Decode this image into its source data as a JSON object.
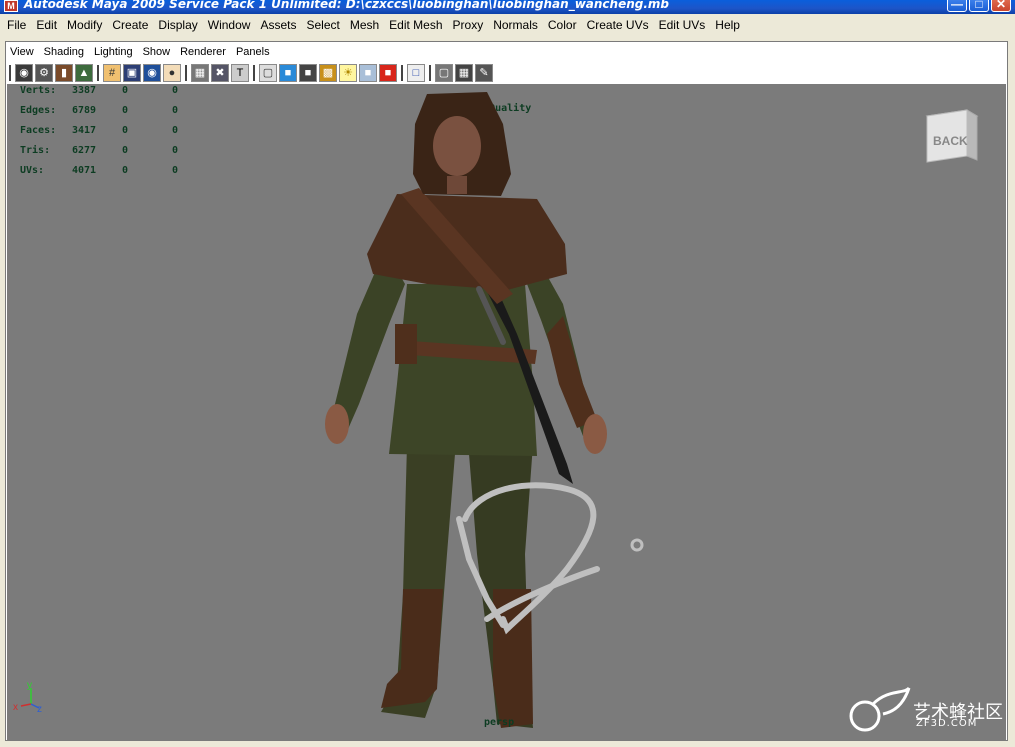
{
  "window": {
    "title": "Autodesk Maya 2009 Service Pack 1 Unlimited: D:\\czxccs\\luobinghan\\luobinghan_wancheng.mb",
    "icon": "maya-icon",
    "buttons": [
      "minimize",
      "maximize",
      "close"
    ]
  },
  "menubar": {
    "items": [
      "File",
      "Edit",
      "Modify",
      "Create",
      "Display",
      "Window",
      "Assets",
      "Select",
      "Mesh",
      "Edit Mesh",
      "Proxy",
      "Normals",
      "Color",
      "Create UVs",
      "Edit UVs",
      "Help"
    ]
  },
  "panel_menu": {
    "items": [
      "View",
      "Shading",
      "Lighting",
      "Show",
      "Renderer",
      "Panels"
    ]
  },
  "toolbar": {
    "groups": [
      [
        "camera-icon",
        "camera-attributes-icon",
        "bookmark-icon",
        "image-plane-icon"
      ],
      [
        "grid-icon",
        "film-gate-icon",
        "resolution-gate-icon",
        "gate-mask-icon"
      ],
      [
        "wireframe-icon",
        "uv-icon",
        "text-icon"
      ],
      [
        "wireframe-shaded-icon",
        "smooth-shade-icon",
        "flat-shade-icon",
        "textured-icon",
        "lights-icon",
        "xray-icon",
        "backface-icon"
      ],
      [
        "isolate-select-icon"
      ],
      [
        "xray-joints-icon",
        "hud-icon",
        "render-settings-icon"
      ]
    ]
  },
  "hud": {
    "rows": [
      {
        "label": "Verts:",
        "v1": "3387",
        "v2": "0",
        "v3": "0"
      },
      {
        "label": "Edges:",
        "v1": "6789",
        "v2": "0",
        "v3": "0"
      },
      {
        "label": "Faces:",
        "v1": "3417",
        "v2": "0",
        "v3": "0"
      },
      {
        "label": "Tris:",
        "v1": "6277",
        "v2": "0",
        "v3": "0"
      },
      {
        "label": "UVs:",
        "v1": "4071",
        "v2": "0",
        "v3": "0"
      }
    ],
    "quality": "High Quality",
    "camera": "persp"
  },
  "view_cube": {
    "face": "BACK"
  },
  "axis": {
    "x": "x",
    "y": "y",
    "z": "z"
  },
  "watermark": {
    "text": "艺术蜂社区",
    "sub": "ZF3D.COM"
  }
}
